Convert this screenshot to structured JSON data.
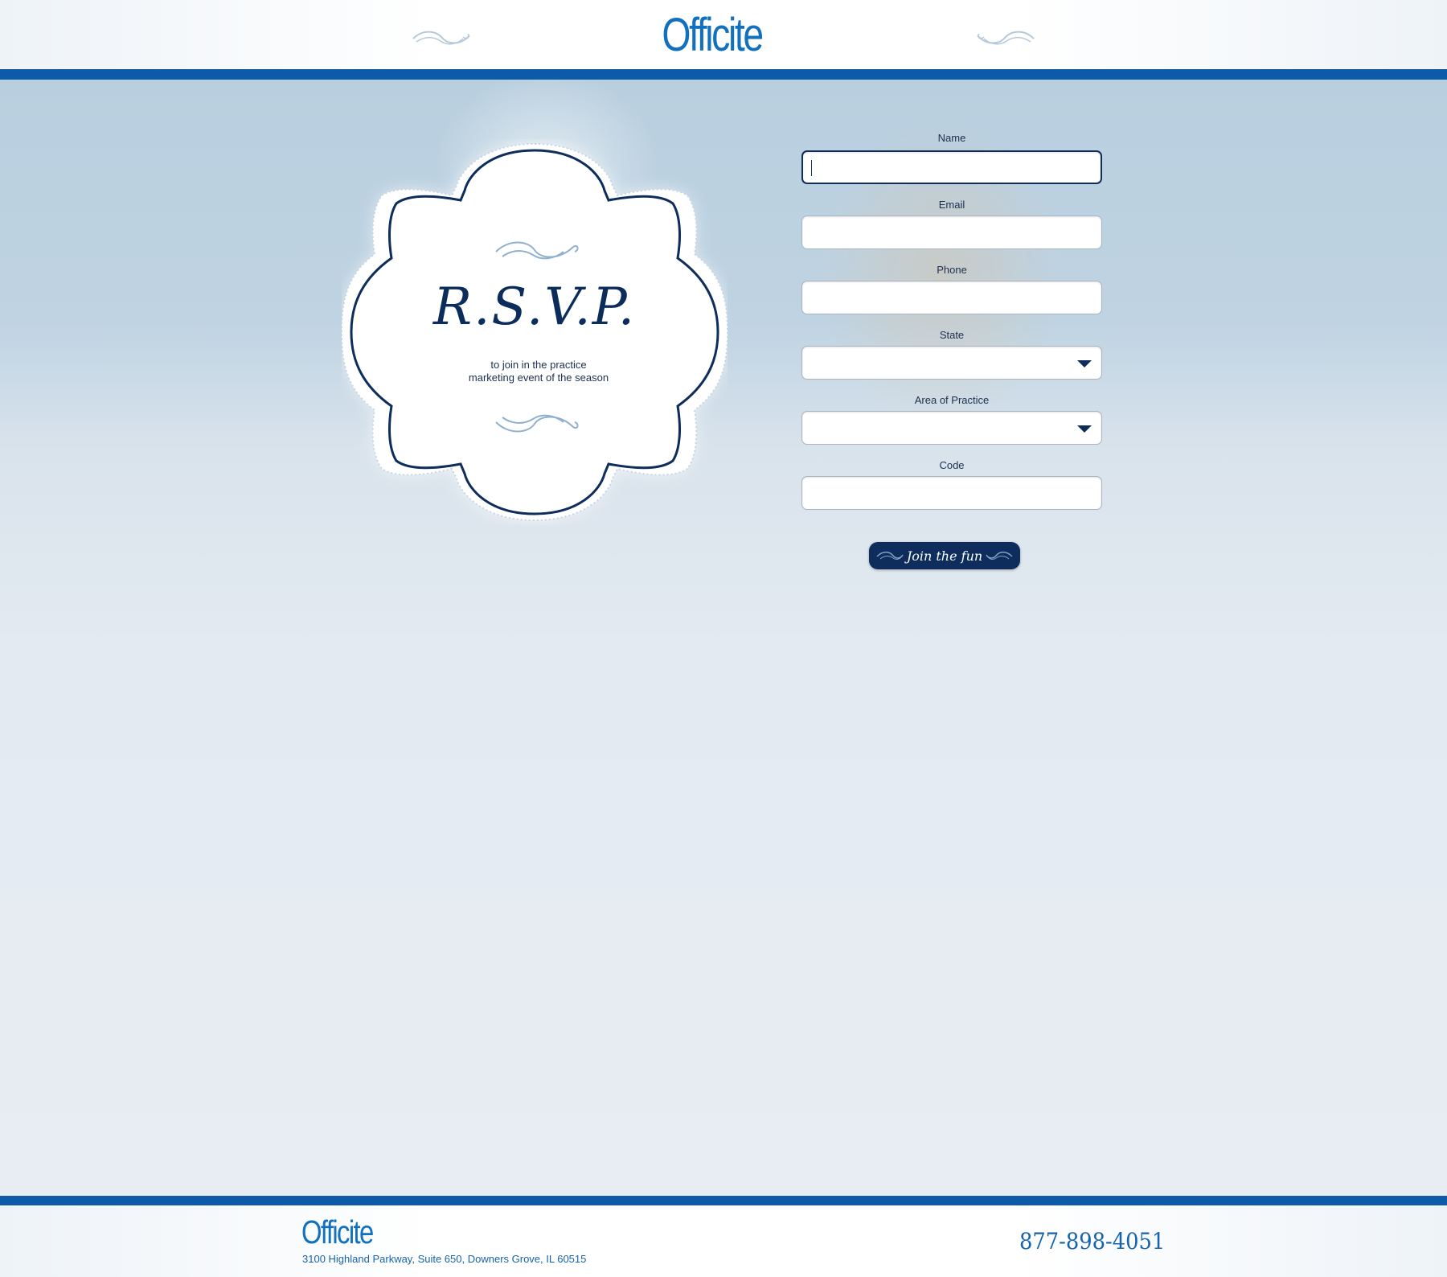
{
  "header": {
    "logo_text": "Officite"
  },
  "badge": {
    "title": "R.S.V.P.",
    "subtitle_line1": "to join in the practice",
    "subtitle_line2": "marketing event of the season"
  },
  "form": {
    "name_label": "Name",
    "name_value": "",
    "email_label": "Email",
    "email_value": "",
    "phone_label": "Phone",
    "phone_value": "",
    "state_label": "State",
    "state_selected": "",
    "practice_label": "Area of Practice",
    "practice_selected": "",
    "code_label": "Code",
    "code_value": "",
    "submit_label": "Join the fun"
  },
  "footer": {
    "logo_text": "Officite",
    "address": "3100 Highland Parkway, Suite 650, Downers Grove, IL 60515",
    "phone": "877-898-4051"
  },
  "colors": {
    "brand_blue": "#1271bf",
    "bar_blue": "#0d5aa8",
    "navy": "#0e2d5c"
  },
  "icons": [
    "flourish-icon",
    "chevron-down-icon"
  ]
}
